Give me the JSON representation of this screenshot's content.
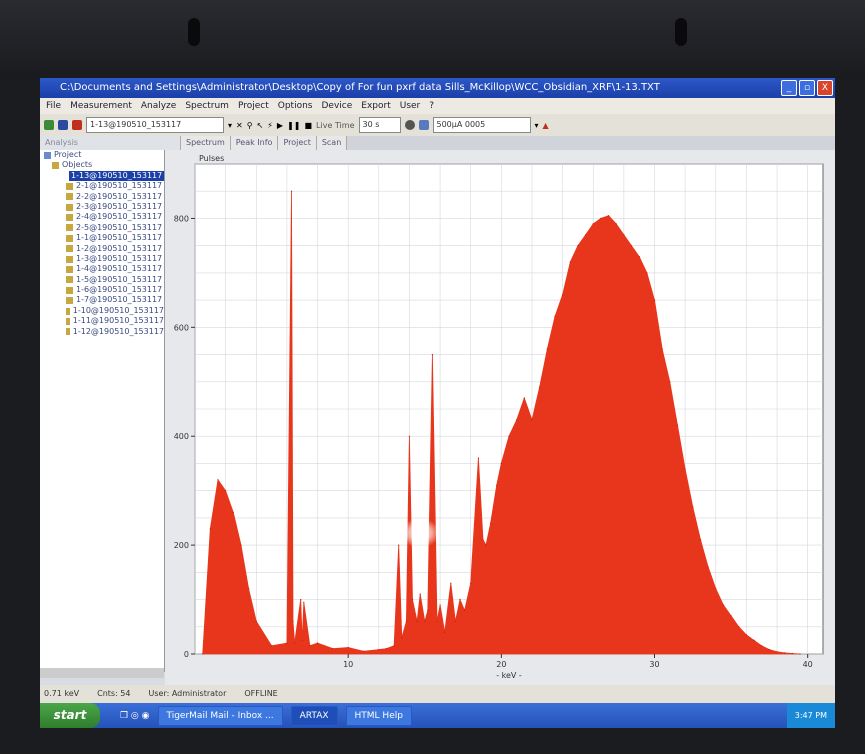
{
  "window": {
    "title": "C:\\Documents and Settings\\Administrator\\Desktop\\Copy of For fun pxrf data Sills_McKillop\\WCC_Obsidian_XRF\\1-13.TXT",
    "buttons": [
      "_",
      "▫",
      "X"
    ]
  },
  "menu": [
    "File",
    "Measurement",
    "Analyze",
    "Spectrum",
    "Project",
    "Options",
    "Device",
    "Export",
    "User",
    "?"
  ],
  "toolbar": {
    "spectrum_select": "1-13@190510_153117",
    "live_time_label": "Live Time",
    "live_time_value": "30 s",
    "device_select": "500µA 0005"
  },
  "tabs": {
    "left_label": "Analysis",
    "items": [
      "Spectrum",
      "Peak Info",
      "Project",
      "Scan"
    ]
  },
  "tree": {
    "root": "Project",
    "objects": "Objects",
    "items": [
      "1-13@190510_153117",
      "2-1@190510_153117",
      "2-2@190510_153117",
      "2-3@190510_153117",
      "2-4@190510_153117",
      "2-5@190510_153117",
      "1-1@190510_153117",
      "1-2@190510_153117",
      "1-3@190510_153117",
      "1-4@190510_153117",
      "1-5@190510_153117",
      "1-6@190510_153117",
      "1-7@190510_153117",
      "1-10@190510_153117",
      "1-11@190510_153117",
      "1-12@190510_153117"
    ],
    "selected_index": 0
  },
  "status": {
    "energy": "0.71 keV",
    "counts": "Cnts: 54",
    "user": "User: Administrator",
    "mode": "OFFLINE"
  },
  "taskbar": {
    "start": "start",
    "tasks": [
      "TigerMail Mail - Inbox ...",
      "ARTAX",
      "HTML Help"
    ],
    "clock": "3:47 PM"
  },
  "colors": {
    "spectrum": "#e8361c",
    "titlebar": "#1c3fa8"
  },
  "chart_data": {
    "type": "area",
    "ylabel": "Pulses",
    "xlabel": "- keV -",
    "xlim": [
      0,
      41
    ],
    "ylim": [
      0,
      900
    ],
    "xticks": [
      10,
      20,
      30,
      40
    ],
    "yticks": [
      0,
      200,
      400,
      600,
      800
    ],
    "grid": true,
    "x": [
      0.5,
      1.0,
      1.5,
      2.0,
      2.5,
      3.0,
      3.5,
      4.0,
      5.0,
      6.0,
      6.3,
      6.4,
      6.5,
      6.9,
      7.0,
      7.1,
      7.5,
      8.0,
      9.0,
      10.0,
      11.0,
      12.0,
      12.5,
      13.0,
      13.3,
      13.5,
      13.8,
      14.0,
      14.2,
      14.5,
      14.7,
      15.0,
      15.2,
      15.5,
      15.8,
      16.0,
      16.3,
      16.7,
      17.0,
      17.3,
      17.6,
      18.0,
      18.5,
      18.8,
      19.0,
      19.3,
      19.7,
      20.0,
      20.5,
      21.0,
      21.5,
      22.0,
      22.5,
      23.0,
      23.5,
      24.0,
      24.5,
      25.0,
      25.5,
      26.0,
      26.5,
      27.0,
      27.5,
      28.0,
      28.5,
      29.0,
      29.5,
      30.0,
      30.5,
      31.0,
      31.5,
      32.0,
      32.5,
      33.0,
      33.5,
      34.0,
      34.5,
      35.0,
      35.5,
      36.0,
      36.5,
      37.0,
      37.5,
      38.0,
      38.5,
      39.0,
      39.5
    ],
    "values": [
      0,
      230,
      320,
      300,
      260,
      200,
      120,
      60,
      15,
      20,
      850,
      60,
      20,
      100,
      25,
      95,
      15,
      20,
      10,
      12,
      5,
      8,
      10,
      15,
      200,
      30,
      60,
      400,
      100,
      60,
      110,
      60,
      80,
      550,
      60,
      90,
      40,
      130,
      60,
      100,
      80,
      130,
      360,
      210,
      200,
      240,
      310,
      350,
      400,
      430,
      470,
      430,
      490,
      560,
      620,
      660,
      720,
      750,
      770,
      790,
      800,
      805,
      790,
      770,
      750,
      730,
      700,
      650,
      560,
      500,
      420,
      340,
      270,
      210,
      160,
      120,
      90,
      70,
      50,
      35,
      25,
      15,
      8,
      4,
      2,
      1,
      0
    ]
  }
}
